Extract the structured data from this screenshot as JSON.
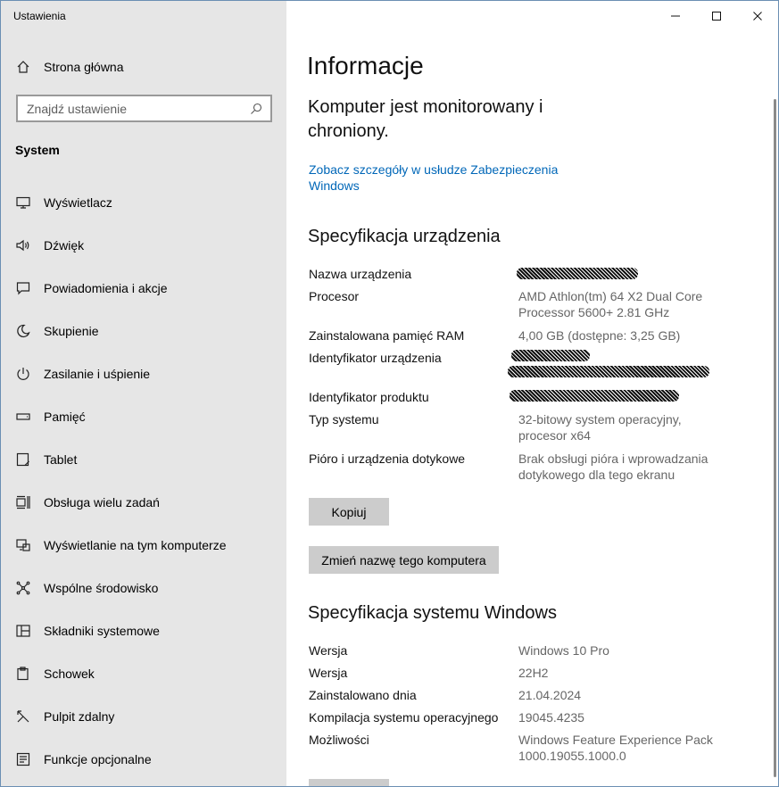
{
  "window": {
    "title": "Ustawienia"
  },
  "sidebar": {
    "home_label": "Strona główna",
    "search_placeholder": "Znajdź ustawienie",
    "section": "System",
    "items": [
      {
        "label": "Wyświetlacz",
        "icon": "display-icon"
      },
      {
        "label": "Dźwięk",
        "icon": "sound-icon"
      },
      {
        "label": "Powiadomienia i akcje",
        "icon": "notifications-icon"
      },
      {
        "label": "Skupienie",
        "icon": "moon-icon"
      },
      {
        "label": "Zasilanie i uśpienie",
        "icon": "power-icon"
      },
      {
        "label": "Pamięć",
        "icon": "storage-icon"
      },
      {
        "label": "Tablet",
        "icon": "tablet-icon"
      },
      {
        "label": "Obsługa wielu zadań",
        "icon": "multitasking-icon"
      },
      {
        "label": "Wyświetlanie na tym komputerze",
        "icon": "projecting-icon"
      },
      {
        "label": "Wspólne środowisko",
        "icon": "shared-experiences-icon"
      },
      {
        "label": "Składniki systemowe",
        "icon": "system-components-icon"
      },
      {
        "label": "Schowek",
        "icon": "clipboard-icon"
      },
      {
        "label": "Pulpit zdalny",
        "icon": "remote-desktop-icon"
      },
      {
        "label": "Funkcje opcjonalne",
        "icon": "optional-features-icon"
      }
    ]
  },
  "main": {
    "title": "Informacje",
    "protection_status": "Komputer jest monitorowany i chroniony.",
    "security_link": "Zobacz szczegóły w usłudze Zabezpieczenia Windows",
    "device_specs": {
      "heading": "Specyfikacja urządzenia",
      "rows": [
        {
          "key": "Nazwa urządzenia",
          "value": ""
        },
        {
          "key": "Procesor",
          "value": "AMD Athlon(tm) 64 X2 Dual Core Processor 5600+   2.81 GHz"
        },
        {
          "key": "Zainstalowana pamięć RAM",
          "value": "4,00 GB (dostępne: 3,25 GB)"
        },
        {
          "key": "Identyfikator urządzenia",
          "value": ""
        },
        {
          "key": "Identyfikator produktu",
          "value": ""
        },
        {
          "key": "Typ systemu",
          "value": "32-bitowy system operacyjny, procesor x64"
        },
        {
          "key": "Pióro i urządzenia dotykowe",
          "value": "Brak obsługi pióra i wprowadzania dotykowego dla tego ekranu"
        }
      ],
      "copy_button": "Kopiuj",
      "rename_button": "Zmień nazwę tego komputera"
    },
    "windows_specs": {
      "heading": "Specyfikacja systemu Windows",
      "rows": [
        {
          "key": "Wersja",
          "value": "Windows 10 Pro"
        },
        {
          "key": "Wersja",
          "value": "22H2"
        },
        {
          "key": "Zainstalowano dnia",
          "value": "21.04.2024"
        },
        {
          "key": "Kompilacja systemu operacyjnego",
          "value": "19045.4235"
        },
        {
          "key": "Możliwości",
          "value": "Windows Feature Experience Pack 1000.19055.1000.0"
        }
      ]
    }
  },
  "colors": {
    "sidebar_bg": "#e6e6e6",
    "link": "#0067b8",
    "button_bg": "#cccccc",
    "value_text": "#666666"
  }
}
